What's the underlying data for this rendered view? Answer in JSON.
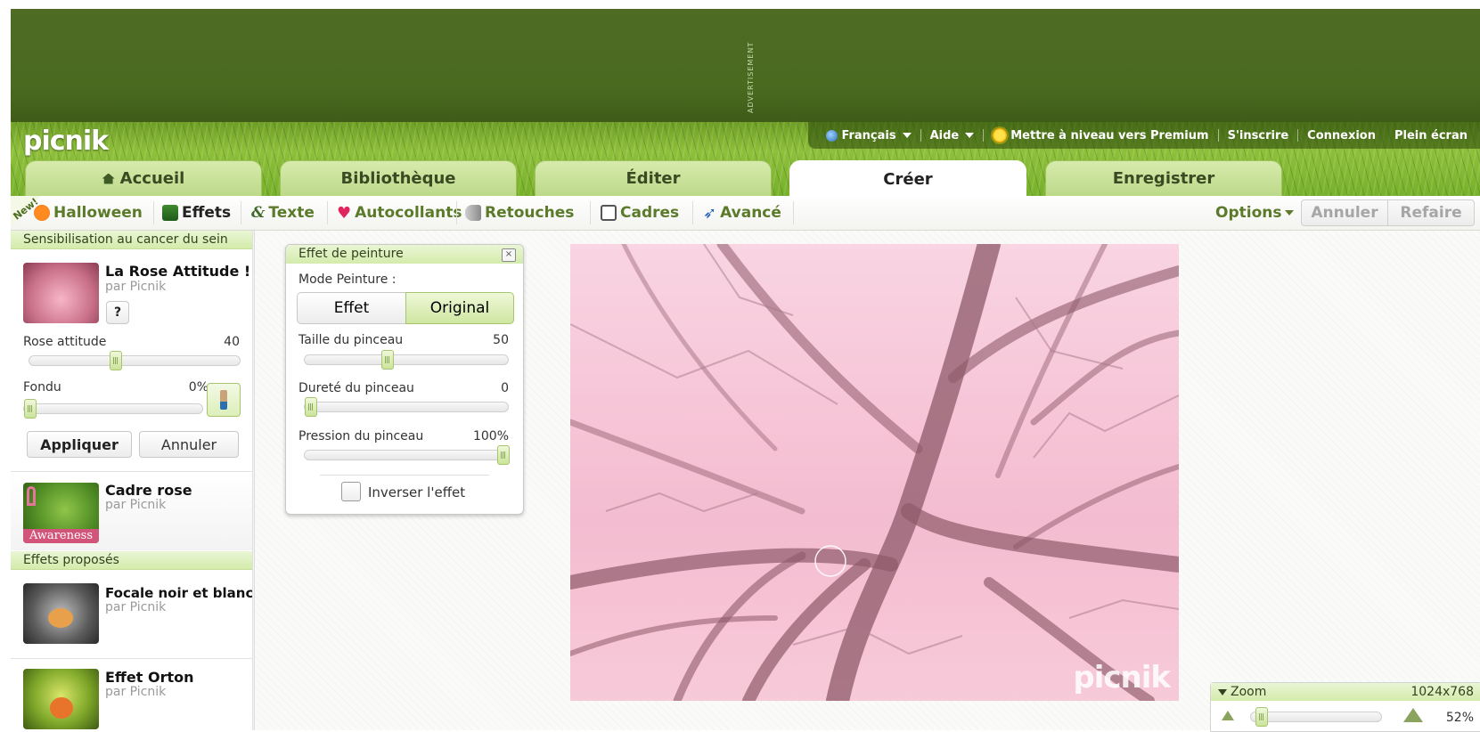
{
  "ad": {
    "label": "ADVERTISEMENT"
  },
  "brand": {
    "logo": "picnik"
  },
  "toplinks": {
    "language": "Français",
    "help": "Aide",
    "premium": "Mettre à niveau vers Premium",
    "signup": "S'inscrire",
    "login": "Connexion",
    "fullscreen": "Plein écran"
  },
  "tabs": [
    {
      "label": "Accueil",
      "active": false
    },
    {
      "label": "Bibliothèque",
      "active": false
    },
    {
      "label": "Éditer",
      "active": false
    },
    {
      "label": "Créer",
      "active": true
    },
    {
      "label": "Enregistrer",
      "active": false
    }
  ],
  "toolbar": {
    "new_badge": "New!",
    "items": [
      "Halloween",
      "Effets",
      "Texte",
      "Autocollants",
      "Retouches",
      "Cadres",
      "Avancé"
    ],
    "options": "Options",
    "undo": "Annuler",
    "redo": "Refaire"
  },
  "left": {
    "section1": "Sensibilisation au cancer du sein",
    "effect1": {
      "title": "La Rose Attitude !",
      "by": "par Picnik",
      "help": "?",
      "slider1_label": "Rose attitude",
      "slider1_value": "40",
      "slider1_fraction": 0.4,
      "slider2_label": "Fondu",
      "slider2_value": "0%",
      "slider2_fraction": 0,
      "apply": "Appliquer",
      "cancel": "Annuler"
    },
    "effect2": {
      "title": "Cadre rose",
      "by": "par Picnik",
      "thumb_caption": "Awareness"
    },
    "section2": "Effets proposés",
    "effect3": {
      "title": "Focale noir et blanc",
      "by": "par Picnik"
    },
    "effect4": {
      "title": "Effet Orton",
      "by": "par Picnik"
    }
  },
  "paint": {
    "title": "Effet de peinture",
    "close": "×",
    "mode_label": "Mode Peinture :",
    "mode_options": [
      "Effet",
      "Original"
    ],
    "mode_selected": "Original",
    "size_label": "Taille du pinceau",
    "size_value": "50",
    "size_fraction": 0.4,
    "hardness_label": "Dureté du pinceau",
    "hardness_value": "0",
    "hardness_fraction": 0,
    "pressure_label": "Pression du pinceau",
    "pressure_value": "100%",
    "pressure_fraction": 1,
    "invert_label": "Inverser l'effet"
  },
  "photo": {
    "watermark": "picnik"
  },
  "zoom": {
    "title": "Zoom",
    "dimensions": "1024x768",
    "percent": "52%",
    "fraction": 0.04
  },
  "colors": {
    "brand_green": "#5b7a2a",
    "panel_header": "#d3ebab",
    "photo_tint": "#f4bcd0"
  }
}
